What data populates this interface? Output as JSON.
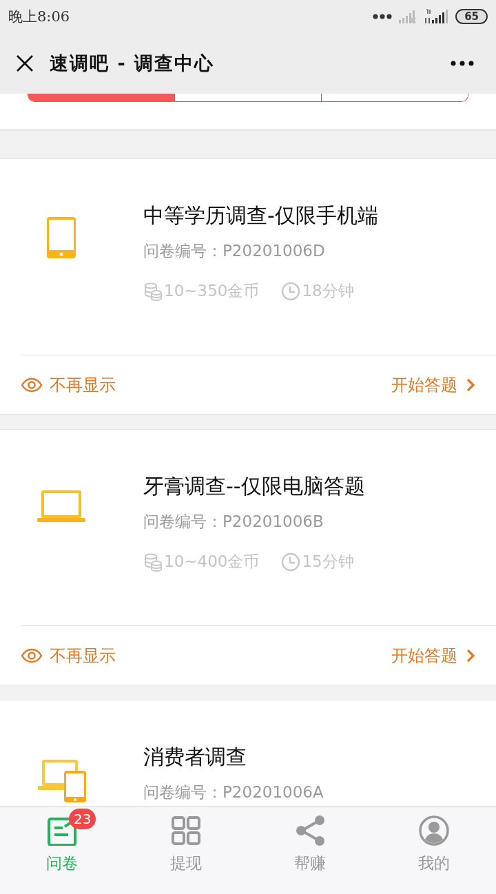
{
  "status_bar": {
    "time": "晚上8:06",
    "battery": "65"
  },
  "header": {
    "title": "速调吧 - 调查中心"
  },
  "segments": [
    {
      "selected": true
    },
    {
      "selected": false
    },
    {
      "selected": false
    }
  ],
  "surveys": [
    {
      "kind": "phone",
      "title": "中等学历调查-仅限手机端",
      "code": "问卷编号：P20201006D",
      "reward": "10~350金币",
      "duration": "18分钟",
      "hide_label": "不再显示",
      "start_label": "开始答题"
    },
    {
      "kind": "laptop",
      "title": "牙膏调查--仅限电脑答题",
      "code": "问卷编号：P20201006B",
      "reward": "10~400金币",
      "duration": "15分钟",
      "hide_label": "不再显示",
      "start_label": "开始答题"
    },
    {
      "kind": "both",
      "title": "消费者调查",
      "code": "问卷编号：P20201006A"
    }
  ],
  "tab_bar": [
    {
      "kind": "survey",
      "label": "问卷",
      "selected": true,
      "badge": "23"
    },
    {
      "kind": "grid",
      "label": "提现",
      "selected": false
    },
    {
      "kind": "share",
      "label": "帮赚",
      "selected": false
    },
    {
      "kind": "user",
      "label": "我的",
      "selected": false
    }
  ]
}
